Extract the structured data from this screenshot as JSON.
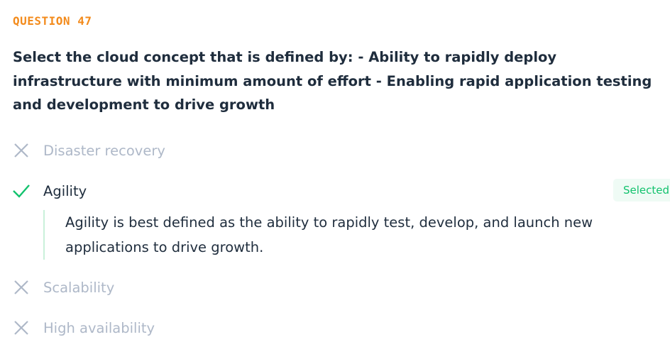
{
  "question_number": "QUESTION 47",
  "question_text": "Select the cloud concept that is defined by: - Ability to rapidly deploy infrastructure with minimum amount of effort - Enabling rapid application testing and development to drive growth",
  "options": [
    {
      "label": "Disaster recovery",
      "status": "incorrect"
    },
    {
      "label": "Agility",
      "status": "correct",
      "badge": "Selected",
      "explanation": "Agility is best defined as the ability to rapidly test, develop, and launch new applications to drive growth."
    },
    {
      "label": "Scalability",
      "status": "incorrect"
    },
    {
      "label": "High availability",
      "status": "incorrect"
    }
  ],
  "colors": {
    "accent": "#f38b1c",
    "correct": "#12c26d",
    "muted": "#aeb8c8",
    "text": "#1f2d3d"
  }
}
